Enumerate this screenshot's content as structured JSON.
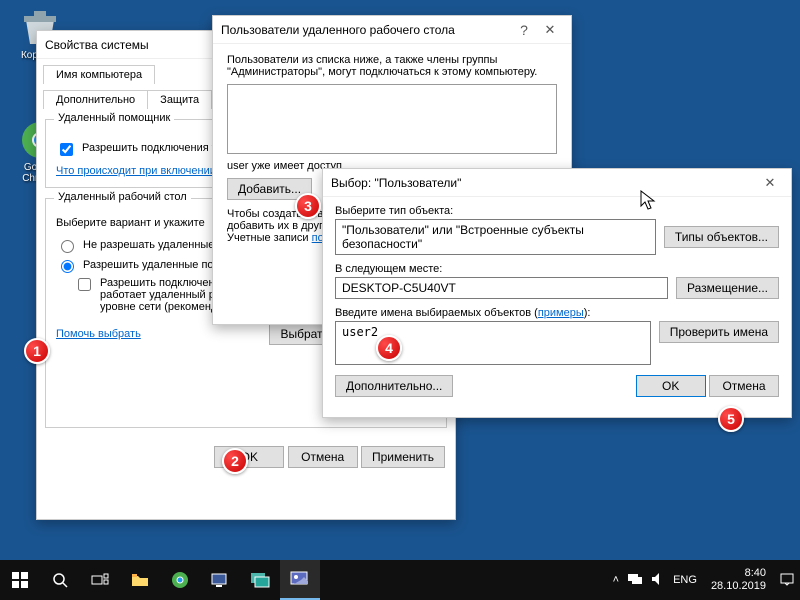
{
  "desktop": {
    "icons": {
      "recycle": "Корзина",
      "chrome": "Google Chrome"
    }
  },
  "sysProps": {
    "title": "Свойства системы",
    "tabs": {
      "computerName": "Имя компьютера",
      "advanced": "Дополнительно",
      "protection": "Защита"
    },
    "remoteAssist": {
      "legend": "Удаленный помощник",
      "allow": "Разрешить подключения удаленного помощника к этому компьютеру",
      "whatHappens": "Что происходит при включении"
    },
    "remoteDesktop": {
      "legend": "Удаленный рабочий стол",
      "choose": "Выберите вариант и укажите",
      "radioNo": "Не разрешать удаленные",
      "radioYes": "Разрешить удаленные подключения к этому компьютеру",
      "nla": "Разрешить подключения только с компьютеров, на которых работает удаленный рабочий стол с проверкой подлинности на уровне сети (рекомендуется)",
      "help": "Помочь выбрать",
      "selectUsers": "Выбрать пользователей..."
    },
    "buttons": {
      "ok": "OK",
      "cancel": "Отмена",
      "apply": "Применить"
    }
  },
  "rdUsers": {
    "title": "Пользователи удаленного рабочего стола",
    "desc": "Пользователи из списка ниже, а также члены группы \"Администраторы\", могут подключаться к этому компьютеру.",
    "already": "user уже имеет доступ",
    "add": "Добавить...",
    "createHint": "Чтобы создать новые учетные записи пользователей или добавить их в другие группы, откройте панель управления: Учетные записи",
    "usersLink": "пользователей."
  },
  "selectUsers": {
    "title": "Выбор: \"Пользователи\"",
    "objectType": "Выберите тип объекта:",
    "objectTypeValue": "\"Пользователи\" или \"Встроенные субъекты безопасности\"",
    "objectTypesBtn": "Типы объектов...",
    "location": "В следующем месте:",
    "locationValue": "DESKTOP-C5U40VT",
    "locationsBtn": "Размещение...",
    "enterNames": "Введите имена выбираемых объектов",
    "examples": "примеры",
    "nameValue": "user2",
    "checkNames": "Проверить имена",
    "advanced": "Дополнительно...",
    "ok": "OK",
    "cancel": "Отмена"
  },
  "taskbar": {
    "lang": "ENG",
    "time": "8:40",
    "date": "28.10.2019"
  }
}
